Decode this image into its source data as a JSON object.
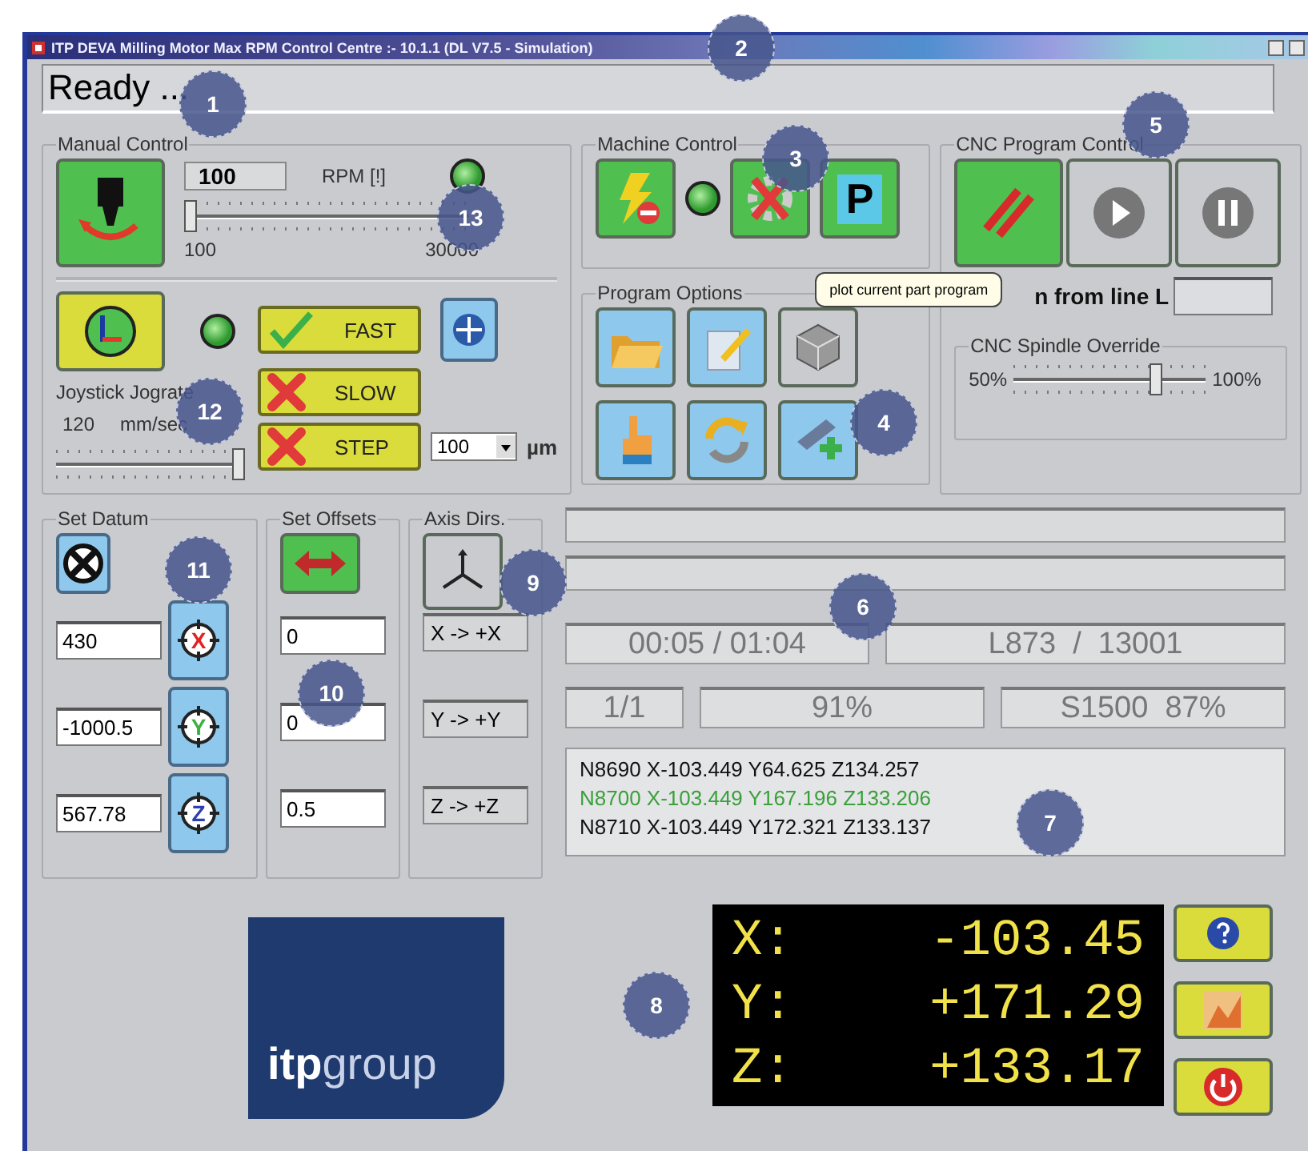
{
  "window": {
    "title": "ITP DEVA Milling Motor Max RPM Control Centre :- 10.1.1 (DL V7.5  - Simulation)"
  },
  "status": "Ready ...",
  "manual_control": {
    "title": "Manual Control",
    "rpm_value": "100",
    "rpm_label": "RPM [!]",
    "rpm_indicator_on": true,
    "rpm_slider": {
      "level": 0.02,
      "min_label": "100",
      "max_label": "30000"
    },
    "joystick_indicator_on": true,
    "jog_modes": [
      {
        "label": "FAST",
        "selected": true
      },
      {
        "label": "SLOW",
        "selected": false
      },
      {
        "label": "STEP",
        "selected": false
      }
    ],
    "step_value": "100",
    "step_unit": "µm",
    "jog_label": "Joystick Jograte",
    "jog_value": "120",
    "jog_unit": "mm/sec",
    "jog_slider": {
      "level": 1
    }
  },
  "machine_control": {
    "title": "Machine Control",
    "indicator_on": true,
    "park_label": "P"
  },
  "program_options": {
    "title": "Program Options",
    "tooltip": "plot current part program"
  },
  "cnc_program_control": {
    "title": "CNC Program Control",
    "run_from_label": "n from line L"
  },
  "spindle_override": {
    "title": "CNC Spindle Override",
    "min_label": "50%",
    "max_label": "100%",
    "level": 0.74
  },
  "set_datum": {
    "title": "Set Datum",
    "axes": [
      {
        "axis": "X",
        "value": "430",
        "color": "#e02424"
      },
      {
        "axis": "Y",
        "value": "-1000.5",
        "color": "#3cb043"
      },
      {
        "axis": "Z",
        "value": "567.78",
        "color": "#2b3fb0"
      }
    ]
  },
  "set_offsets": {
    "title": "Set Offsets",
    "values": [
      "0",
      "0",
      "0.5"
    ]
  },
  "axis_dirs": {
    "title": "Axis Dirs.",
    "mappings": [
      "X -> +X",
      "Y -> +Y",
      "Z -> +Z"
    ]
  },
  "progress": {
    "time": "00:05 / 01:04",
    "line": "L873  /  13001",
    "count": "1/1",
    "percent": "91%",
    "spindle": "S1500  87%"
  },
  "code_lines": [
    {
      "text": "N8690 X-103.449 Y64.625 Z134.257",
      "current": false
    },
    {
      "text": "N8700 X-103.449 Y167.196 Z133.206",
      "current": true
    },
    {
      "text": "N8710 X-103.449 Y172.321 Z133.137",
      "current": false
    }
  ],
  "dro": [
    {
      "axis": "X:",
      "value": "-103.45"
    },
    {
      "axis": "Y:",
      "value": "+171.29"
    },
    {
      "axis": "Z:",
      "value": "+133.17"
    }
  ],
  "logo": {
    "bold": "itp",
    "light": "group"
  },
  "callouts": [
    "2",
    "1",
    "5",
    "3",
    "13",
    "4",
    "12",
    "11",
    "6",
    "9",
    "10",
    "7",
    "8"
  ]
}
